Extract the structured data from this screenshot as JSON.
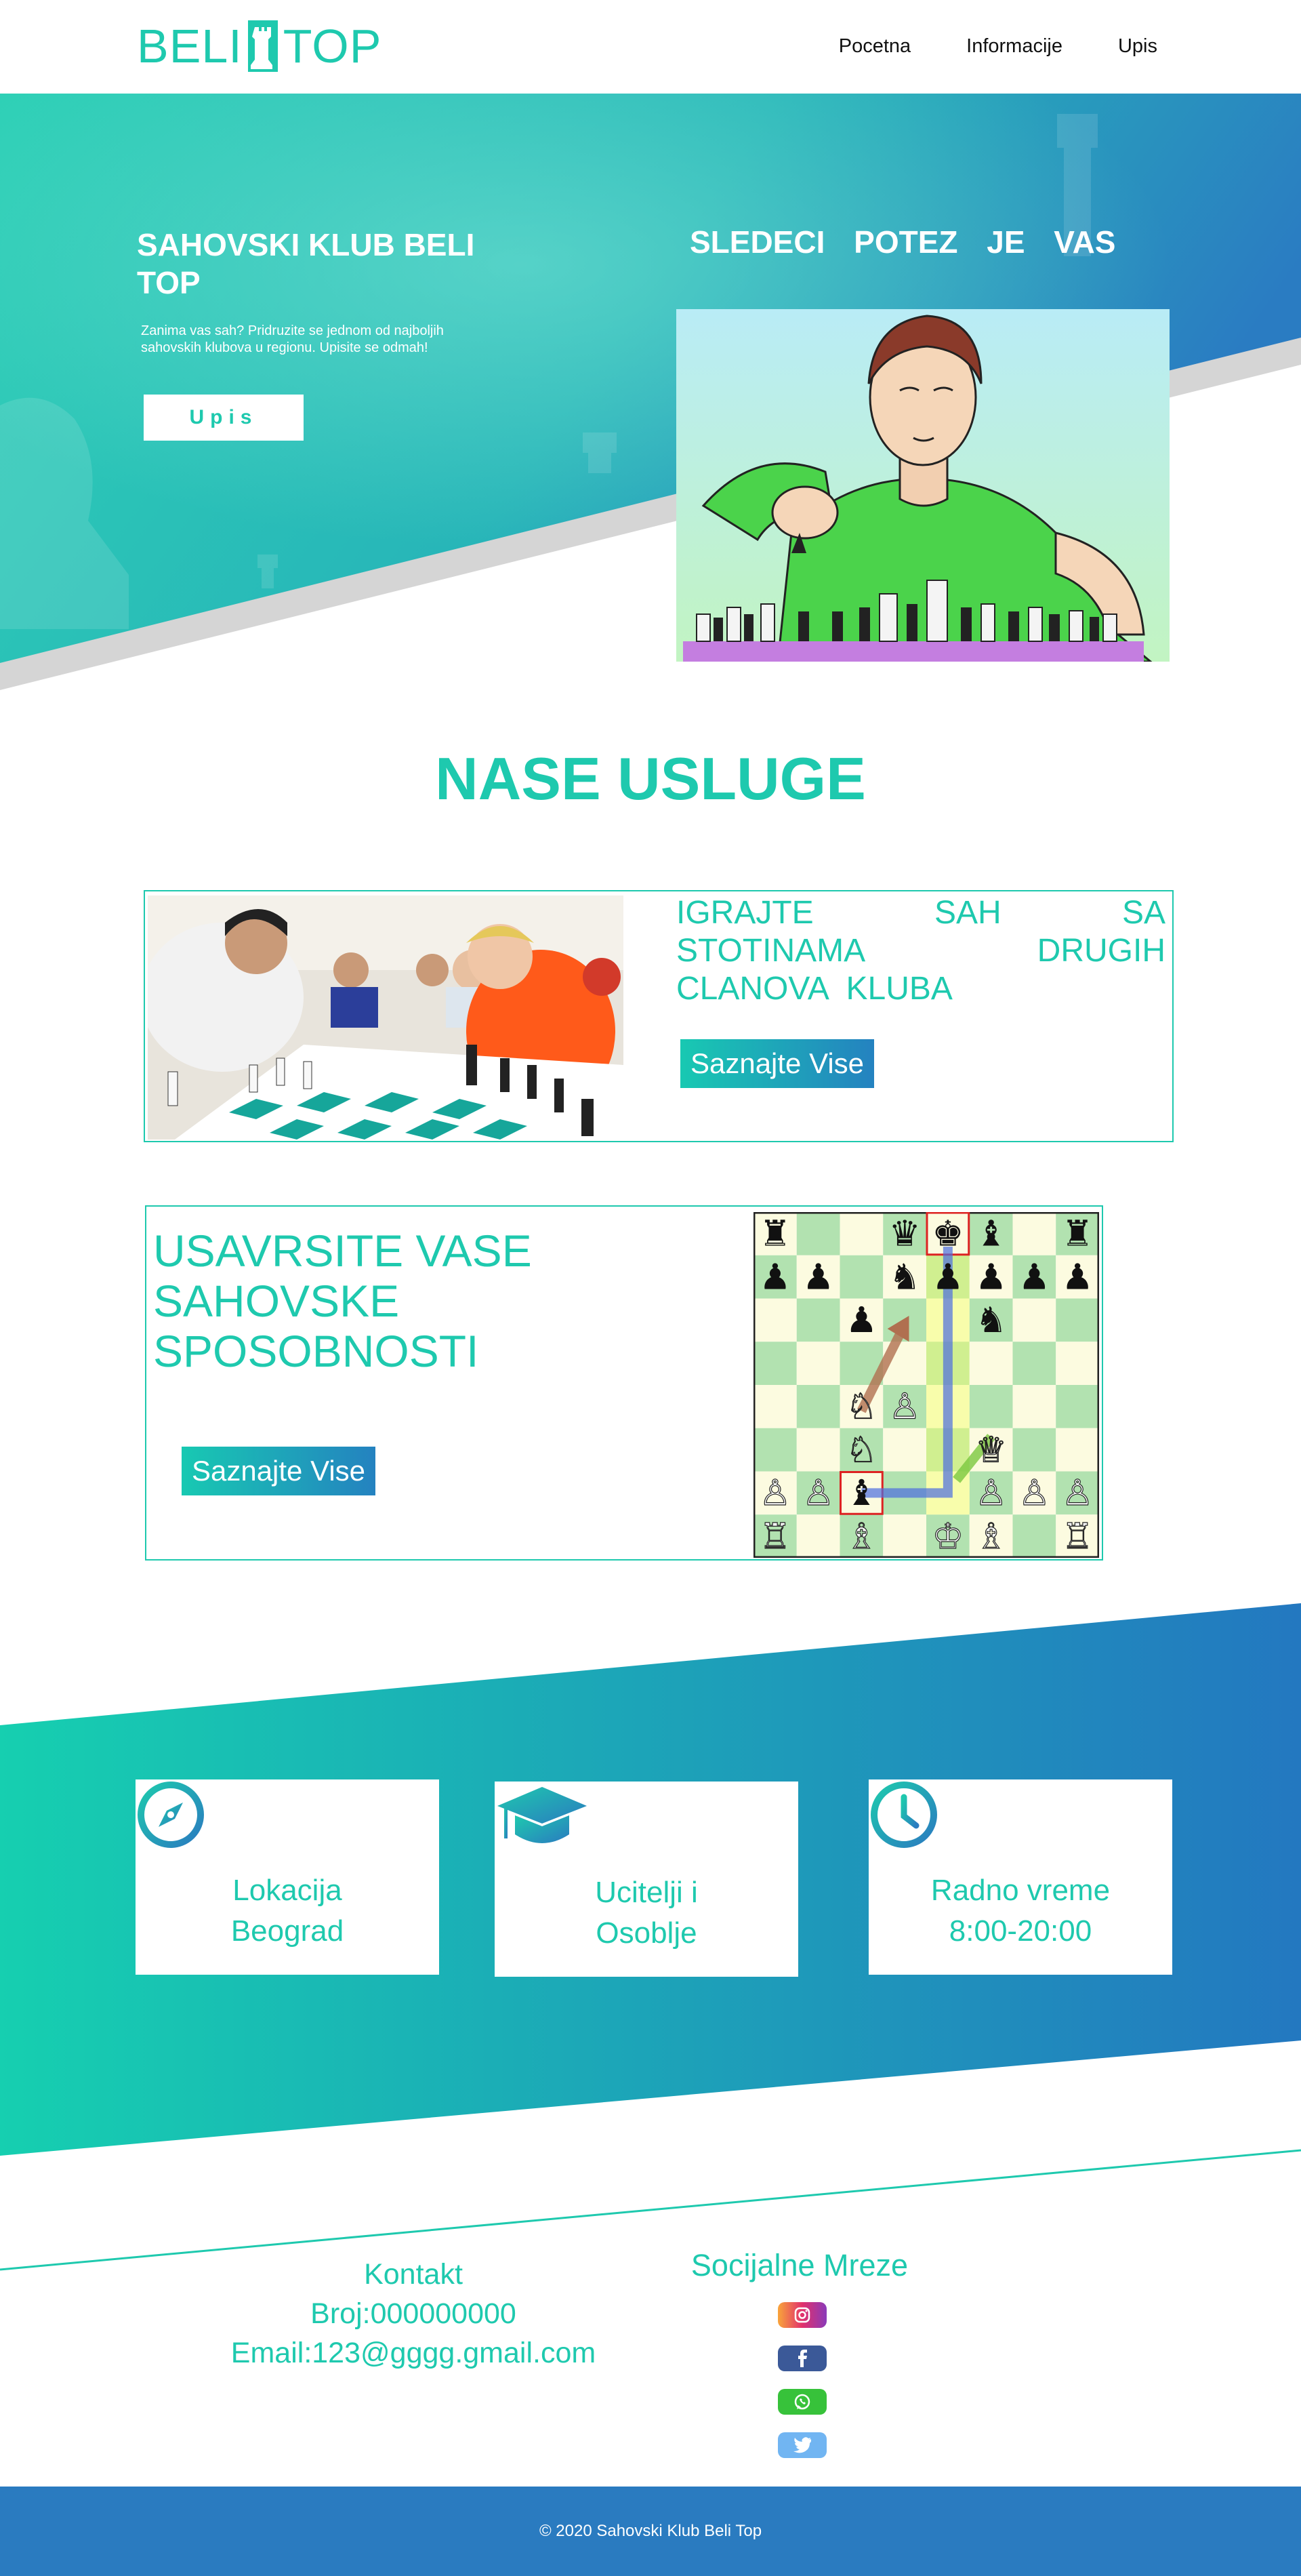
{
  "nav": {
    "logo_left": "BELI",
    "logo_right": "TOP",
    "links": [
      "Pocetna",
      "Informacije",
      "Upis"
    ]
  },
  "hero": {
    "title": "SAHOVSKI KLUB BELI TOP",
    "text": "Zanima vas sah? Pridruzite se jednom od najboljih sahovskih klubova u regionu. Upisite se odmah!",
    "button": "Upis",
    "slogan": "SLEDECI POTEZ JE VAS"
  },
  "services": {
    "title": "NASE USLUGE",
    "card1": {
      "text": "IGRAJTE SAH SA STOTINAMA DRUGIH CLANOVA KLUBA",
      "button": "Saznajte Vise"
    },
    "card2": {
      "text": "USAVRSITE VASE SAHOVSKE SPOSOBNOSTI",
      "button": "Saznajte Vise"
    }
  },
  "features": [
    {
      "icon": "compass-icon",
      "line1": "Lokacija",
      "line2": "Beograd"
    },
    {
      "icon": "graduation-cap-icon",
      "line1": "Ucitelji i",
      "line2": "Osoblje"
    },
    {
      "icon": "clock-icon",
      "line1": "Radno vreme",
      "line2": "8:00-20:00"
    }
  ],
  "contact": {
    "title": "Kontakt",
    "phone": "Broj:000000000",
    "email": "Email:123@gggg.gmail.com"
  },
  "social": {
    "title": "Socijalne Mreze",
    "items": [
      "instagram-icon",
      "facebook-icon",
      "whatsapp-icon",
      "twitter-icon"
    ]
  },
  "footer": {
    "copyright": "© 2020 Sahovski Klub Beli Top"
  },
  "colors": {
    "accent": "#1ec9ae",
    "blue": "#2a7bc0"
  }
}
